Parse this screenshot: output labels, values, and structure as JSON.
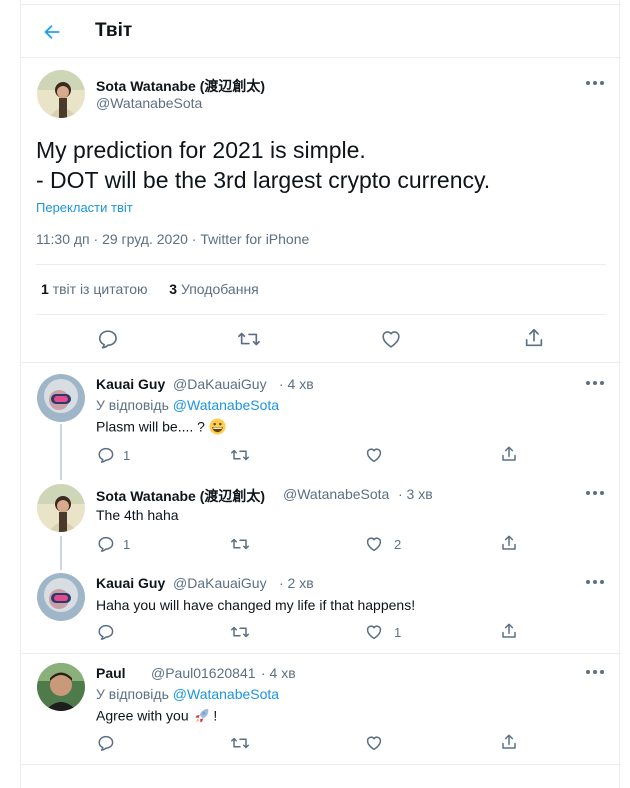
{
  "header": {
    "title": "Твіт"
  },
  "main_tweet": {
    "name": "Sota Watanabe (渡辺創太)",
    "handle": "@WatanabeSota",
    "text_line1": "My prediction for 2021 is simple.",
    "text_line2": "- DOT will be the 3rd largest crypto currency.",
    "translate": "Перекласти твіт",
    "meta": "11:30 дп · 29 груд. 2020 · Twitter for iPhone",
    "quote_count": "1",
    "quote_label": "твіт із цитатою",
    "like_count": "3",
    "like_label": "Уподобання"
  },
  "replies": [
    {
      "name": "Kauai Guy",
      "handle": "@DaKauaiGuy",
      "time": "· 4 хв",
      "reply_prefix": "У відповідь",
      "reply_to": "@WatanabeSota",
      "text": "Plasm will be.... ?",
      "emoji": "grinning-face",
      "reply_count": "1",
      "like_count": ""
    },
    {
      "name": "Sota Watanabe (渡辺創太)",
      "handle": "@WatanabeSota",
      "time": "· 3 хв",
      "text": "The 4th haha",
      "reply_count": "1",
      "like_count": "2"
    },
    {
      "name": "Kauai Guy",
      "handle": "@DaKauaiGuy",
      "time": "· 2 хв",
      "text": "Haha you will have changed my life if that happens!",
      "reply_count": "",
      "like_count": "1"
    },
    {
      "name": "Paul",
      "handle": "@Paul01620841",
      "time": "· 4 хв",
      "reply_prefix": "У відповідь",
      "reply_to": "@WatanabeSota",
      "text": "Agree with you",
      "text_suffix": "!",
      "emoji": "rocket",
      "reply_count": "",
      "like_count": ""
    }
  ],
  "colors": {
    "accent": "#1b95e0",
    "muted": "#5b7083",
    "border": "#ebeef0"
  }
}
